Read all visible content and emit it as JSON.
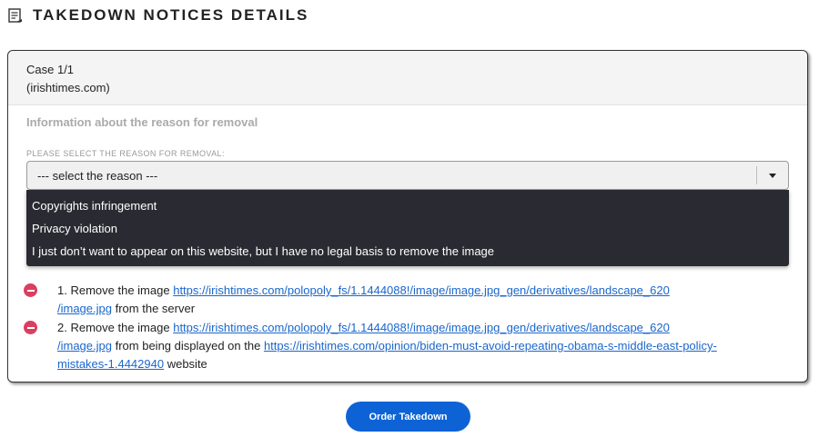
{
  "header": {
    "title": "TAKEDOWN NOTICES DETAILS",
    "icon": "document-list-icon"
  },
  "case": {
    "title": "Case 1/1",
    "domain": "(irishtimes.com)",
    "section_title": "Information about the reason for removal",
    "reason_label": "PLEASE SELECT THE REASON FOR REMOVAL:",
    "reason_select": {
      "value": "--- select the reason ---",
      "options": [
        "Copyrights infringement",
        "Privacy violation",
        "I just don’t want to appear on this website, but I have no legal basis to remove the image"
      ]
    },
    "steps": [
      {
        "number": "1.",
        "prefix": "Remove the image",
        "image_url_line1": "https://irishtimes.com/polopoly_fs/1.1444088!/image/image.jpg_gen/derivatives/landscape_620",
        "image_url_line2": "/image.jpg",
        "suffix": "from the server"
      },
      {
        "number": "2.",
        "prefix": "Remove the image",
        "image_url_line1": "https://irishtimes.com/polopoly_fs/1.1444088!/image/image.jpg_gen/derivatives/landscape_620",
        "image_url_line2": "/image.jpg",
        "middle": "from being displayed on the",
        "page_url_line1": "https://irishtimes.com/opinion/biden-must-avoid-repeating-obama-s-middle-east-policy-",
        "page_url_line2": "mistakes-1.4442940",
        "suffix": "website"
      }
    ]
  },
  "actions": {
    "order_label": "Order Takedown"
  },
  "colors": {
    "primary": "#0d63d6",
    "danger": "#d9405f",
    "link": "#1a66cc",
    "dropdown_bg": "#2a2a32"
  }
}
